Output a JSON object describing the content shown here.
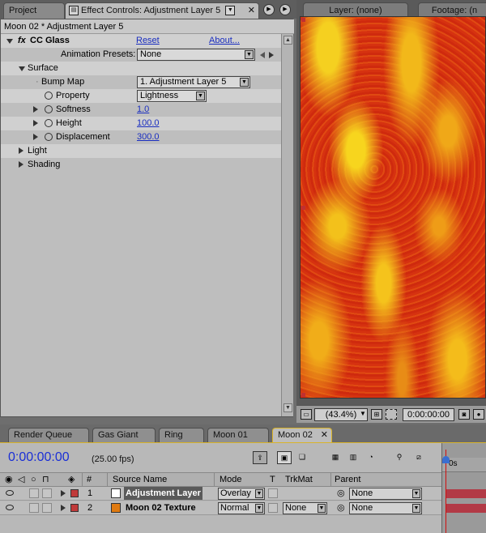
{
  "top_tabs": {
    "project": "Project",
    "effect_controls": "Effect Controls: Adjustment Layer 5",
    "layer": "Layer: (none)",
    "footage": "Footage: (n"
  },
  "effect_controls": {
    "title": "Moon 02 * Adjustment Layer 5",
    "effect": {
      "fx_badge": "fx",
      "name": "CC Glass",
      "reset": "Reset",
      "about": "About...",
      "presets_label": "Animation Presets:",
      "presets_value": "None"
    },
    "surface": {
      "label": "Surface",
      "bump_map_label": "Bump Map",
      "bump_map_value": "1. Adjustment Layer 5",
      "property_label": "Property",
      "property_value": "Lightness",
      "softness_label": "Softness",
      "softness_value": "1.0",
      "height_label": "Height",
      "height_value": "100.0",
      "displacement_label": "Displacement",
      "displacement_value": "300.0"
    },
    "light_label": "Light",
    "shading_label": "Shading"
  },
  "viewer": {
    "zoom": "(43.4%)",
    "timecode": "0:00:00:00"
  },
  "bottom_tabs": [
    "Render Queue",
    "Gas Giant",
    "Ring",
    "Moon 01",
    "Moon 02"
  ],
  "timeline": {
    "timecode": "0:00:00:00",
    "fps": "(25.00 fps)",
    "ruler_label": "0s",
    "headers": {
      "number": "#",
      "source_name": "Source Name",
      "mode": "Mode",
      "t": "T",
      "trkmat": "TrkMat",
      "parent": "Parent"
    },
    "layers": [
      {
        "number": "1",
        "name": "Adjustment Layer",
        "mode": "Overlay",
        "trkmat": "",
        "parent": "None",
        "label_color": "#c03a3a",
        "swatch_color": "#ffffff"
      },
      {
        "number": "2",
        "name": "Moon 02 Texture",
        "mode": "Normal",
        "trkmat": "None",
        "parent": "None",
        "label_color": "#c03a3a",
        "swatch_color": "#e07a10"
      }
    ]
  }
}
